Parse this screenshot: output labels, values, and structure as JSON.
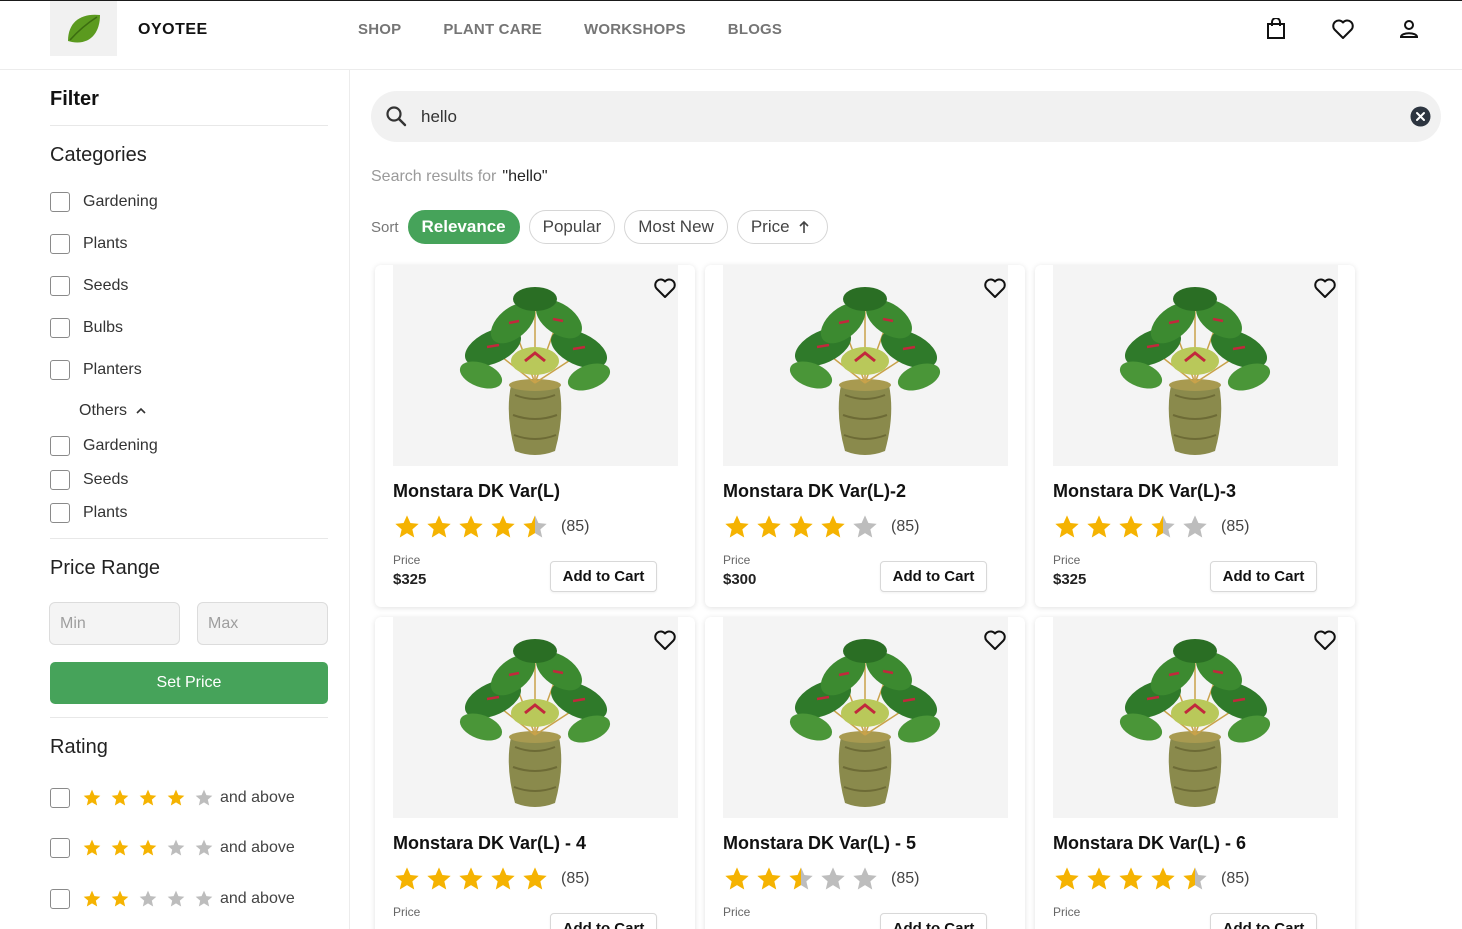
{
  "brand": {
    "name": "OYOTEE",
    "logo_icon": "leaf-icon"
  },
  "nav": [
    "SHOP",
    "PLANT CARE",
    "WORKSHOPS",
    "BLOGS"
  ],
  "header_icons": [
    "cart-bag-icon",
    "heart-icon",
    "user-icon"
  ],
  "filter": {
    "title": "Filter",
    "categories_title": "Categories",
    "categories": [
      "Gardening",
      "Plants",
      "Seeds",
      "Bulbs",
      "Planters"
    ],
    "others_label": "Others",
    "others": [
      "Gardening",
      "Seeds",
      "Plants"
    ],
    "price_range_title": "Price Range",
    "min_placeholder": "Min",
    "max_placeholder": "Max",
    "set_price_label": "Set Price",
    "rating_title": "Rating",
    "and_above_label": "and above",
    "rating_rows": [
      4,
      3,
      2
    ]
  },
  "search": {
    "value": "hello",
    "results_label": "Search results for",
    "results_query": "\"hello\""
  },
  "sort": {
    "label": "Sort",
    "options": [
      "Relevance",
      "Popular",
      "Most New",
      "Price"
    ],
    "active": "Relevance",
    "price_direction": "up"
  },
  "colors": {
    "accent": "#46a35a",
    "star": "#f5b301",
    "star_empty": "#bdbdbd"
  },
  "product_labels": {
    "price_label": "Price",
    "add_to_cart": "Add to Cart"
  },
  "products": [
    {
      "name": "Monstara DK Var(L)",
      "rating": 4.5,
      "reviews": "(85)",
      "price": "$325"
    },
    {
      "name": "Monstara DK Var(L)-2",
      "rating": 4,
      "reviews": "(85)",
      "price": "$300"
    },
    {
      "name": "Monstara DK Var(L)-3",
      "rating": 3.5,
      "reviews": "(85)",
      "price": "$325"
    },
    {
      "name": "Monstara DK Var(L) - 4",
      "rating": 5,
      "reviews": "(85)",
      "price": ""
    },
    {
      "name": "Monstara DK Var(L) - 5",
      "rating": 2.5,
      "reviews": "(85)",
      "price": ""
    },
    {
      "name": "Monstara DK Var(L) - 6",
      "rating": 4.5,
      "reviews": "(85)",
      "price": ""
    }
  ]
}
